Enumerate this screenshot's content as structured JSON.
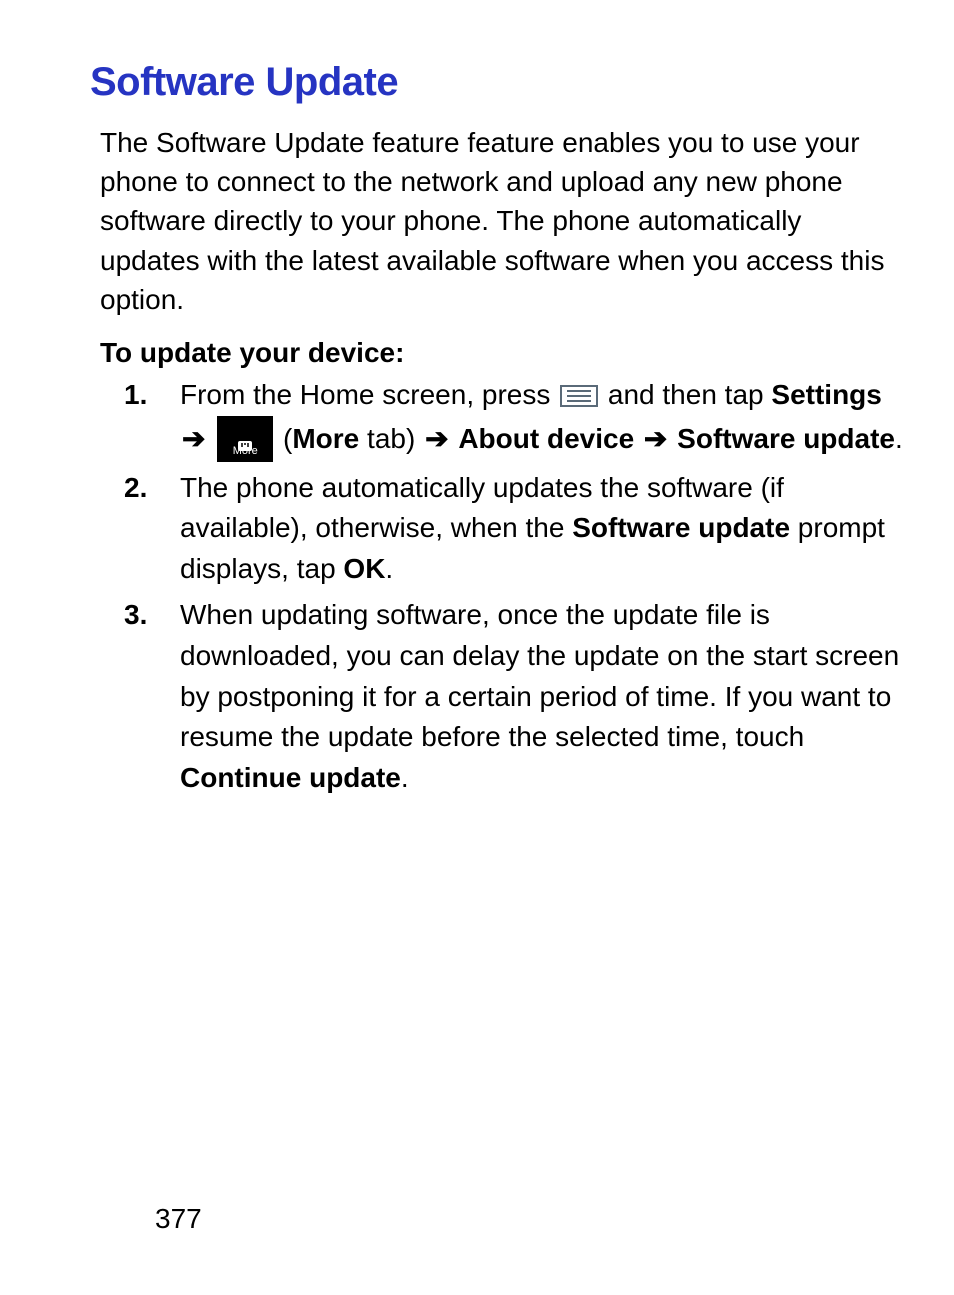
{
  "heading": "Software Update",
  "intro": "The Software Update feature feature enables you to use your phone to connect to the network and upload any new phone software directly to your phone. The phone automatically updates with the latest available software when you access this option.",
  "subhead": "To update your device:",
  "arrow_glyph": "➔",
  "more_icon_label": "More",
  "step1": {
    "p1": "From the Home screen, press ",
    "p2": " and then tap ",
    "settings": "Settings",
    "p3": " (",
    "more_bold": "More",
    "p4": " tab) ",
    "about": "About device",
    "sw": "Software update",
    "end": "."
  },
  "step2": {
    "p1": "The phone automatically updates the software (if available), otherwise, when the ",
    "sw": "Software update",
    "p2": " prompt displays, tap ",
    "ok": "OK",
    "end": "."
  },
  "step3": {
    "p1": "When updating software, once the update file is downloaded, you can delay the update on the start screen by postponing it for a certain period of time. If you want to resume the update before the selected time, touch ",
    "cont": "Continue update",
    "end": "."
  },
  "page_number": "377"
}
